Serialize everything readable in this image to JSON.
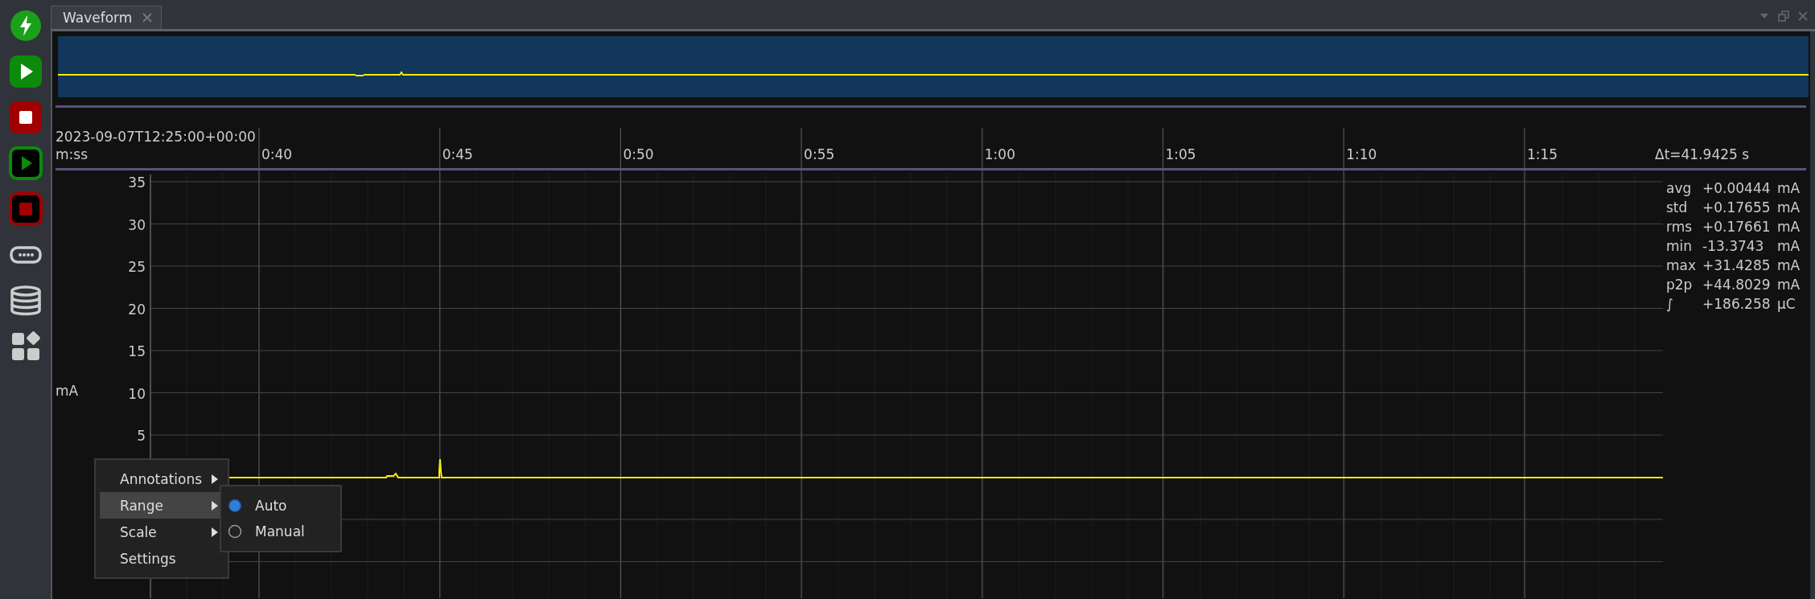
{
  "tab": {
    "title": "Waveform"
  },
  "timeline": {
    "start": "2023-09-07T12:25:00+00:00",
    "format": "m:ss",
    "ticks": [
      "0:40",
      "0:45",
      "0:50",
      "0:55",
      "1:00",
      "1:05",
      "1:10",
      "1:15"
    ],
    "delta": "Δt=41.9425 s"
  },
  "y_axis": {
    "unit": "mA",
    "ticks": [
      "35",
      "30",
      "25",
      "20",
      "15",
      "10",
      "5"
    ]
  },
  "stats": [
    {
      "label": "avg",
      "value": "+0.00444",
      "unit": "mA"
    },
    {
      "label": "std",
      "value": "+0.17655",
      "unit": "mA"
    },
    {
      "label": "rms",
      "value": "+0.17661",
      "unit": "mA"
    },
    {
      "label": "min",
      "value": "-13.3743",
      "unit": "mA"
    },
    {
      "label": "max",
      "value": "+31.4285",
      "unit": "mA"
    },
    {
      "label": "p2p",
      "value": "+44.8029",
      "unit": "mA"
    },
    {
      "label": "∫",
      "value": "+186.258",
      "unit": "μC"
    }
  ],
  "context_menu": {
    "items": [
      {
        "label": "Annotations",
        "submenu": true,
        "selected": false
      },
      {
        "label": "Range",
        "submenu": true,
        "selected": true
      },
      {
        "label": "Scale",
        "submenu": true,
        "selected": false
      },
      {
        "label": "Settings",
        "submenu": false,
        "selected": false
      }
    ]
  },
  "range_submenu": {
    "options": [
      {
        "label": "Auto",
        "selected": true
      },
      {
        "label": "Manual",
        "selected": false
      }
    ]
  }
}
